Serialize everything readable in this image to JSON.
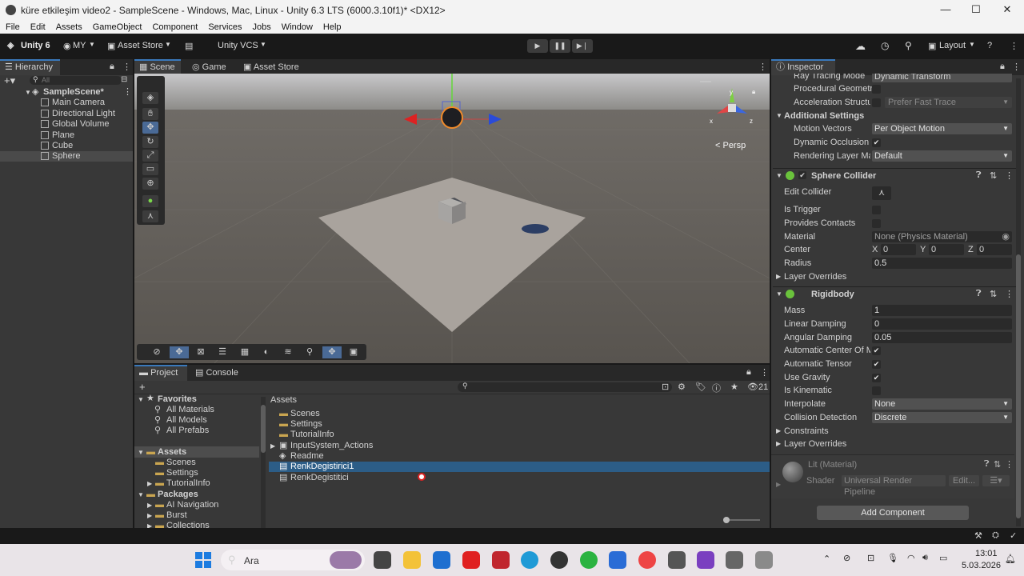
{
  "window": {
    "title": "küre etkileşim video2 - SampleScene - Windows, Mac, Linux - Unity 6.3 LTS (6000.3.10f1)* <DX12>",
    "minimize": "—",
    "maximize": "☐",
    "close": "✕"
  },
  "menu": [
    "File",
    "Edit",
    "Assets",
    "GameObject",
    "Component",
    "Services",
    "Jobs",
    "Window",
    "Help"
  ],
  "toolbar": {
    "unity_label": "Unity 6",
    "account": "MY",
    "asset_store": "Asset Store",
    "vcs": "Unity VCS",
    "layout": "Layout"
  },
  "hierarchy": {
    "tab": "Hierarchy",
    "search_placeholder": "All",
    "scene": "SampleScene*",
    "items": [
      "Main Camera",
      "Directional Light",
      "Global Volume",
      "Plane",
      "Cube",
      "Sphere"
    ]
  },
  "scene_tabs": [
    "Scene",
    "Game",
    "Asset Store"
  ],
  "scene_view": {
    "persp_label": "< Persp"
  },
  "project": {
    "tabs": [
      "Project",
      "Console"
    ],
    "count_badge": "21",
    "favorites_label": "Favorites",
    "favorites": [
      "All Materials",
      "All Models",
      "All Prefabs"
    ],
    "assets_label": "Assets",
    "assets_tree": [
      "Scenes",
      "Settings",
      "TutorialInfo"
    ],
    "packages_label": "Packages",
    "packages": [
      "AI Navigation",
      "Burst",
      "Collections"
    ],
    "breadcrumb": "Assets",
    "asset_list": [
      "Scenes",
      "Settings",
      "TutorialInfo",
      "InputSystem_Actions",
      "Readme",
      "RenkDegistirici1",
      "RenkDegistitici"
    ]
  },
  "inspector": {
    "tab": "Inspector",
    "ray_tracing_label": "Ray Tracing Mode",
    "ray_tracing_value": "Dynamic Transform",
    "procedural_label": "Procedural Geometry",
    "accel_label": "Acceleration Structu",
    "accel_value": "Prefer Fast Trace",
    "additional_settings": "Additional Settings",
    "motion_vectors_label": "Motion Vectors",
    "motion_vectors_value": "Per Object Motion",
    "dynamic_occlusion_label": "Dynamic Occlusion",
    "rendering_layer_label": "Rendering Layer Mas",
    "rendering_layer_value": "Default",
    "sphere_collider": {
      "title": "Sphere Collider",
      "edit_collider": "Edit Collider",
      "is_trigger": "Is Trigger",
      "provides_contacts": "Provides Contacts",
      "material_label": "Material",
      "material_value": "None (Physics Material)",
      "center_label": "Center",
      "cx": "0",
      "cy": "0",
      "cz": "0",
      "radius_label": "Radius",
      "radius_value": "0.5",
      "layer_overrides": "Layer Overrides"
    },
    "rigidbody": {
      "title": "Rigidbody",
      "mass_label": "Mass",
      "mass_value": "1",
      "linear_label": "Linear Damping",
      "linear_value": "0",
      "angular_label": "Angular Damping",
      "angular_value": "0.05",
      "auto_center_label": "Automatic Center Of M",
      "auto_tensor_label": "Automatic Tensor",
      "use_gravity_label": "Use Gravity",
      "kinematic_label": "Is Kinematic",
      "interpolate_label": "Interpolate",
      "interpolate_value": "None",
      "collision_label": "Collision Detection",
      "collision_value": "Discrete",
      "constraints": "Constraints",
      "layer_overrides": "Layer Overrides"
    },
    "material": {
      "name": "Lit (Material)",
      "shader_label": "Shader",
      "shader_value": "Universal Render Pipeline",
      "edit_btn": "Edit..."
    },
    "add_component": "Add Component"
  },
  "taskbar": {
    "search": "Ara",
    "time": "13:01",
    "date": "5.03.2026"
  }
}
